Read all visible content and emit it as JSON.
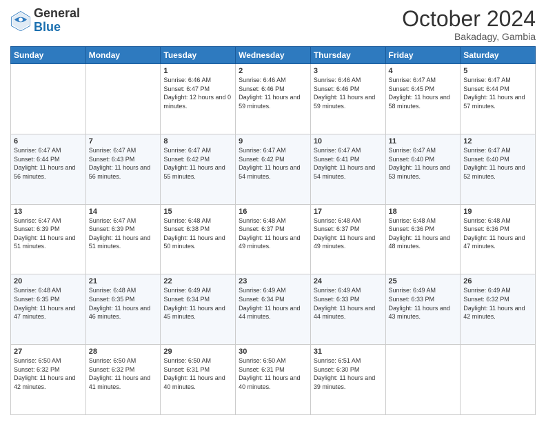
{
  "header": {
    "logo_general": "General",
    "logo_blue": "Blue",
    "month_title": "October 2024",
    "location": "Bakadagy, Gambia"
  },
  "weekdays": [
    "Sunday",
    "Monday",
    "Tuesday",
    "Wednesday",
    "Thursday",
    "Friday",
    "Saturday"
  ],
  "weeks": [
    [
      {
        "day": "",
        "sunrise": "",
        "sunset": "",
        "daylight": ""
      },
      {
        "day": "",
        "sunrise": "",
        "sunset": "",
        "daylight": ""
      },
      {
        "day": "1",
        "sunrise": "Sunrise: 6:46 AM",
        "sunset": "Sunset: 6:47 PM",
        "daylight": "Daylight: 12 hours and 0 minutes."
      },
      {
        "day": "2",
        "sunrise": "Sunrise: 6:46 AM",
        "sunset": "Sunset: 6:46 PM",
        "daylight": "Daylight: 11 hours and 59 minutes."
      },
      {
        "day": "3",
        "sunrise": "Sunrise: 6:46 AM",
        "sunset": "Sunset: 6:46 PM",
        "daylight": "Daylight: 11 hours and 59 minutes."
      },
      {
        "day": "4",
        "sunrise": "Sunrise: 6:47 AM",
        "sunset": "Sunset: 6:45 PM",
        "daylight": "Daylight: 11 hours and 58 minutes."
      },
      {
        "day": "5",
        "sunrise": "Sunrise: 6:47 AM",
        "sunset": "Sunset: 6:44 PM",
        "daylight": "Daylight: 11 hours and 57 minutes."
      }
    ],
    [
      {
        "day": "6",
        "sunrise": "Sunrise: 6:47 AM",
        "sunset": "Sunset: 6:44 PM",
        "daylight": "Daylight: 11 hours and 56 minutes."
      },
      {
        "day": "7",
        "sunrise": "Sunrise: 6:47 AM",
        "sunset": "Sunset: 6:43 PM",
        "daylight": "Daylight: 11 hours and 56 minutes."
      },
      {
        "day": "8",
        "sunrise": "Sunrise: 6:47 AM",
        "sunset": "Sunset: 6:42 PM",
        "daylight": "Daylight: 11 hours and 55 minutes."
      },
      {
        "day": "9",
        "sunrise": "Sunrise: 6:47 AM",
        "sunset": "Sunset: 6:42 PM",
        "daylight": "Daylight: 11 hours and 54 minutes."
      },
      {
        "day": "10",
        "sunrise": "Sunrise: 6:47 AM",
        "sunset": "Sunset: 6:41 PM",
        "daylight": "Daylight: 11 hours and 54 minutes."
      },
      {
        "day": "11",
        "sunrise": "Sunrise: 6:47 AM",
        "sunset": "Sunset: 6:40 PM",
        "daylight": "Daylight: 11 hours and 53 minutes."
      },
      {
        "day": "12",
        "sunrise": "Sunrise: 6:47 AM",
        "sunset": "Sunset: 6:40 PM",
        "daylight": "Daylight: 11 hours and 52 minutes."
      }
    ],
    [
      {
        "day": "13",
        "sunrise": "Sunrise: 6:47 AM",
        "sunset": "Sunset: 6:39 PM",
        "daylight": "Daylight: 11 hours and 51 minutes."
      },
      {
        "day": "14",
        "sunrise": "Sunrise: 6:47 AM",
        "sunset": "Sunset: 6:39 PM",
        "daylight": "Daylight: 11 hours and 51 minutes."
      },
      {
        "day": "15",
        "sunrise": "Sunrise: 6:48 AM",
        "sunset": "Sunset: 6:38 PM",
        "daylight": "Daylight: 11 hours and 50 minutes."
      },
      {
        "day": "16",
        "sunrise": "Sunrise: 6:48 AM",
        "sunset": "Sunset: 6:37 PM",
        "daylight": "Daylight: 11 hours and 49 minutes."
      },
      {
        "day": "17",
        "sunrise": "Sunrise: 6:48 AM",
        "sunset": "Sunset: 6:37 PM",
        "daylight": "Daylight: 11 hours and 49 minutes."
      },
      {
        "day": "18",
        "sunrise": "Sunrise: 6:48 AM",
        "sunset": "Sunset: 6:36 PM",
        "daylight": "Daylight: 11 hours and 48 minutes."
      },
      {
        "day": "19",
        "sunrise": "Sunrise: 6:48 AM",
        "sunset": "Sunset: 6:36 PM",
        "daylight": "Daylight: 11 hours and 47 minutes."
      }
    ],
    [
      {
        "day": "20",
        "sunrise": "Sunrise: 6:48 AM",
        "sunset": "Sunset: 6:35 PM",
        "daylight": "Daylight: 11 hours and 47 minutes."
      },
      {
        "day": "21",
        "sunrise": "Sunrise: 6:48 AM",
        "sunset": "Sunset: 6:35 PM",
        "daylight": "Daylight: 11 hours and 46 minutes."
      },
      {
        "day": "22",
        "sunrise": "Sunrise: 6:49 AM",
        "sunset": "Sunset: 6:34 PM",
        "daylight": "Daylight: 11 hours and 45 minutes."
      },
      {
        "day": "23",
        "sunrise": "Sunrise: 6:49 AM",
        "sunset": "Sunset: 6:34 PM",
        "daylight": "Daylight: 11 hours and 44 minutes."
      },
      {
        "day": "24",
        "sunrise": "Sunrise: 6:49 AM",
        "sunset": "Sunset: 6:33 PM",
        "daylight": "Daylight: 11 hours and 44 minutes."
      },
      {
        "day": "25",
        "sunrise": "Sunrise: 6:49 AM",
        "sunset": "Sunset: 6:33 PM",
        "daylight": "Daylight: 11 hours and 43 minutes."
      },
      {
        "day": "26",
        "sunrise": "Sunrise: 6:49 AM",
        "sunset": "Sunset: 6:32 PM",
        "daylight": "Daylight: 11 hours and 42 minutes."
      }
    ],
    [
      {
        "day": "27",
        "sunrise": "Sunrise: 6:50 AM",
        "sunset": "Sunset: 6:32 PM",
        "daylight": "Daylight: 11 hours and 42 minutes."
      },
      {
        "day": "28",
        "sunrise": "Sunrise: 6:50 AM",
        "sunset": "Sunset: 6:32 PM",
        "daylight": "Daylight: 11 hours and 41 minutes."
      },
      {
        "day": "29",
        "sunrise": "Sunrise: 6:50 AM",
        "sunset": "Sunset: 6:31 PM",
        "daylight": "Daylight: 11 hours and 40 minutes."
      },
      {
        "day": "30",
        "sunrise": "Sunrise: 6:50 AM",
        "sunset": "Sunset: 6:31 PM",
        "daylight": "Daylight: 11 hours and 40 minutes."
      },
      {
        "day": "31",
        "sunrise": "Sunrise: 6:51 AM",
        "sunset": "Sunset: 6:30 PM",
        "daylight": "Daylight: 11 hours and 39 minutes."
      },
      {
        "day": "",
        "sunrise": "",
        "sunset": "",
        "daylight": ""
      },
      {
        "day": "",
        "sunrise": "",
        "sunset": "",
        "daylight": ""
      }
    ]
  ]
}
